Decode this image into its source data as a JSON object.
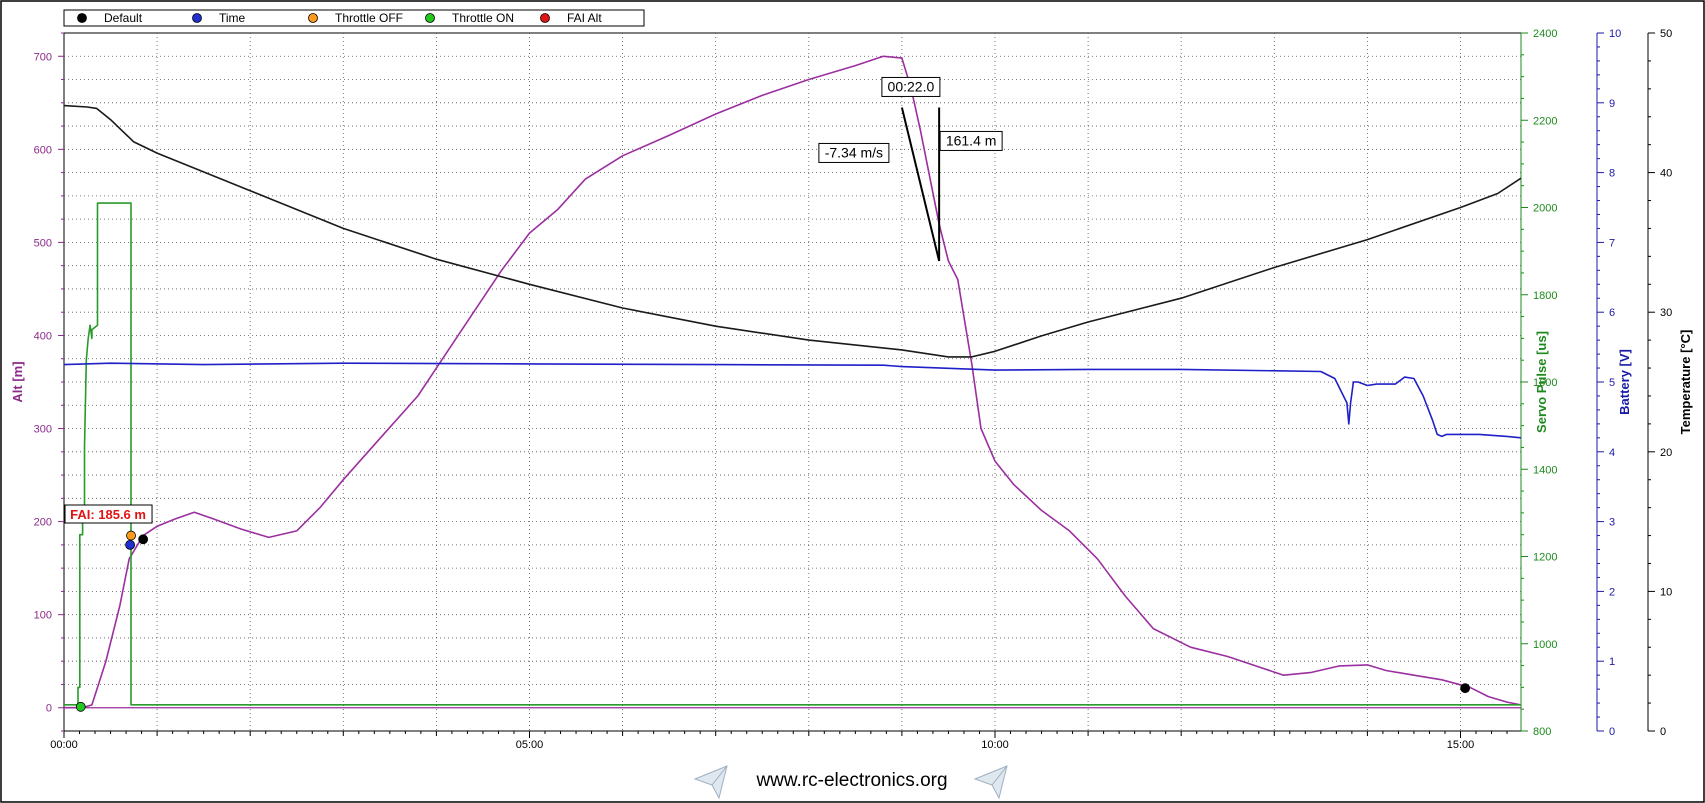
{
  "legend": {
    "items": [
      {
        "label": "Default",
        "color": "#000000"
      },
      {
        "label": "Time",
        "color": "#1f2fd0"
      },
      {
        "label": "Throttle OFF",
        "color": "#ff9a1a"
      },
      {
        "label": "Throttle ON",
        "color": "#22c81e"
      },
      {
        "label": "FAI Alt",
        "color": "#e01414"
      }
    ]
  },
  "footer": {
    "url": "www.rc-electronics.org",
    "icon": "paper-plane-icon"
  },
  "chart_data": {
    "type": "line",
    "grid": true,
    "legend_position": "top-left",
    "x_axis": {
      "range_min": [
        0,
        15.65
      ],
      "ticks": [
        "00:00",
        "05:00",
        "10:00",
        "15:00"
      ],
      "tick_values_min": [
        0,
        5,
        10,
        15
      ]
    },
    "axes": {
      "alt": {
        "label": "Alt [m]",
        "range": [
          -25,
          725
        ],
        "ticks": [
          0,
          100,
          200,
          300,
          400,
          500,
          600,
          700
        ],
        "color": "#8a2a8a"
      },
      "servo": {
        "label": "Servo Pulse [us]",
        "range": [
          800,
          2400
        ],
        "ticks": [
          800,
          1000,
          1200,
          1400,
          1600,
          1800,
          2000,
          2200,
          2400
        ],
        "color": "#1e8a1e"
      },
      "battery": {
        "label": "Battery [V]",
        "range": [
          0,
          10
        ],
        "ticks": [
          0,
          1,
          2,
          3,
          4,
          5,
          6,
          7,
          8,
          9,
          10
        ],
        "color": "#1a1aa8"
      },
      "temperature": {
        "label": "Temperature [°C]",
        "range": [
          0,
          50
        ],
        "ticks": [
          0,
          10,
          20,
          30,
          40,
          50
        ],
        "color": "#000000"
      }
    },
    "series": [
      {
        "id": "altitude",
        "axis": "alt",
        "color": "#9b2fa0",
        "x": [
          0,
          0.2,
          0.3,
          0.45,
          0.6,
          0.7,
          0.85,
          1.0,
          1.2,
          1.4,
          1.6,
          1.9,
          2.2,
          2.5,
          2.75,
          3.0,
          3.4,
          3.8,
          4.1,
          4.4,
          4.7,
          5.0,
          5.3,
          5.6,
          6.0,
          6.5,
          7.0,
          7.5,
          8.0,
          8.5,
          8.8,
          9.0,
          9.1,
          9.2,
          9.3,
          9.4,
          9.5,
          9.6,
          9.65,
          9.75,
          9.85,
          10.0,
          10.2,
          10.5,
          10.8,
          11.1,
          11.4,
          11.7,
          12.1,
          12.5,
          12.8,
          13.1,
          13.4,
          13.7,
          14.0,
          14.2,
          14.5,
          14.8,
          15.1,
          15.3,
          15.5,
          15.65
        ],
        "y": [
          0,
          0,
          3,
          50,
          110,
          160,
          185,
          195,
          203,
          210,
          203,
          192,
          183,
          190,
          215,
          245,
          290,
          335,
          380,
          425,
          470,
          510,
          535,
          568,
          593,
          615,
          638,
          658,
          675,
          690,
          700,
          698,
          665,
          620,
          570,
          520,
          480,
          460,
          430,
          370,
          300,
          265,
          240,
          212,
          190,
          160,
          120,
          85,
          65,
          55,
          45,
          35,
          38,
          45,
          46,
          40,
          35,
          30,
          22,
          12,
          6,
          3
        ]
      },
      {
        "id": "servo-pulse",
        "axis": "servo",
        "color": "#2a9a2a",
        "x": [
          0,
          0.15,
          0.15,
          0.17,
          0.17,
          0.2,
          0.2,
          0.22,
          0.22,
          0.24,
          0.26,
          0.28,
          0.3,
          0.3,
          0.36,
          0.36,
          0.72,
          0.72,
          15.65
        ],
        "y": [
          860,
          860,
          900,
          900,
          1250,
          1250,
          1300,
          1300,
          1450,
          1650,
          1700,
          1730,
          1700,
          1720,
          1730,
          2010,
          2010,
          860,
          860
        ]
      },
      {
        "id": "battery",
        "axis": "battery",
        "color": "#2020c8",
        "x": [
          0,
          0.5,
          1.5,
          3,
          5,
          7,
          8.8,
          9.0,
          10.0,
          11,
          12,
          13.5,
          13.65,
          13.78,
          13.8,
          13.82,
          13.85,
          13.9,
          14.0,
          14.1,
          14.3,
          14.4,
          14.5,
          14.6,
          14.7,
          14.75,
          14.8,
          14.85,
          14.9,
          15.2,
          15.5,
          15.65
        ],
        "y": [
          5.25,
          5.27,
          5.25,
          5.27,
          5.26,
          5.25,
          5.24,
          5.22,
          5.17,
          5.18,
          5.18,
          5.15,
          5.05,
          4.7,
          4.4,
          4.7,
          5.0,
          5.0,
          4.95,
          4.97,
          4.97,
          5.07,
          5.05,
          4.8,
          4.45,
          4.25,
          4.22,
          4.25,
          4.25,
          4.25,
          4.22,
          4.2
        ]
      },
      {
        "id": "temperature",
        "axis": "temperature",
        "color": "#1a1a1a",
        "x": [
          0,
          0.25,
          0.35,
          0.5,
          0.75,
          1,
          2,
          3,
          4,
          5,
          6,
          7,
          8,
          9,
          9.5,
          9.75,
          10.0,
          10.5,
          11,
          12,
          13,
          14,
          15,
          15.4,
          15.65
        ],
        "y": [
          44.8,
          44.7,
          44.6,
          43.8,
          42.2,
          41.4,
          38.7,
          36,
          33.8,
          32,
          30.3,
          29,
          28,
          27.3,
          26.8,
          26.8,
          27.2,
          28.3,
          29.3,
          31,
          33.2,
          35.2,
          37.5,
          38.5,
          39.6
        ]
      }
    ],
    "markers": [
      {
        "name": "default-start",
        "color": "#000000",
        "x": 0.85,
        "y": 181
      },
      {
        "name": "default-end",
        "color": "#000000",
        "x": 15.05,
        "y": 21
      },
      {
        "name": "time",
        "color": "#1f2fd0",
        "x": 0.71,
        "y": 175
      },
      {
        "name": "throttle-off",
        "color": "#ff9a1a",
        "x": 0.72,
        "y": 185
      },
      {
        "name": "throttle-on",
        "color": "#22c81e",
        "x": 0.18,
        "y": 1
      }
    ],
    "measurement": {
      "x1": 9.0,
      "y1": 645,
      "x2": 9.4,
      "y2": 480,
      "time_label": "00:22.0",
      "rate_label": "-7.34 m/s",
      "height_label": "161.4 m"
    },
    "fai": {
      "label": "FAI: 185.6 m",
      "x": 0.72,
      "y": 185.6
    }
  }
}
